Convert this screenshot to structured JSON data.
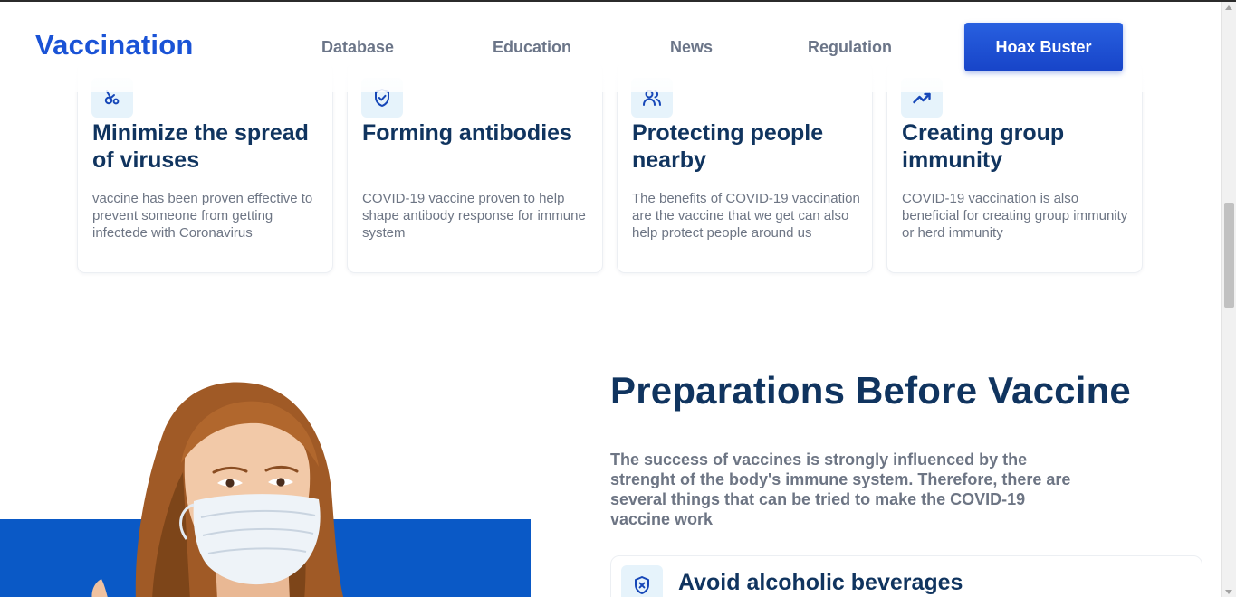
{
  "nav": {
    "brand": "Vaccination",
    "links": [
      {
        "label": "Database"
      },
      {
        "label": "Education"
      },
      {
        "label": "News"
      },
      {
        "label": "Regulation"
      }
    ],
    "cta": "Hoax Buster"
  },
  "benefits": [
    {
      "icon": "virus-icon",
      "title": "Minimize the spread of viruses",
      "text": "vaccine has been proven effective to prevent someone from getting infectede with Coronavirus"
    },
    {
      "icon": "shield-check-icon",
      "title": "Forming antibodies",
      "text": "COVID-19 vaccine proven to help shape antibody response for immune system"
    },
    {
      "icon": "people-icon",
      "title": "Protecting people nearby",
      "text": "The benefits of COVID-19 vaccination are the vaccine that we get can also help protect people around us"
    },
    {
      "icon": "trending-up-icon",
      "title": "Creating group immunity",
      "text": "COVID-19 vaccination is also beneficial for creating group immunity or herd immunity"
    }
  ],
  "preparation": {
    "title": "Preparations Before Vaccine",
    "text": "The success of vaccines is strongly influenced by the strenght of the body's immune system. Therefore, there are several things that can be tried to make the COVID-19 vaccine work",
    "tips": [
      {
        "icon": "shield-x-icon",
        "title": "Avoid alcoholic beverages"
      }
    ]
  },
  "colors": {
    "brand": "#1a53d6",
    "heading": "#10345f",
    "body_text": "#6d7584",
    "icon_bg": "#e6f3fb",
    "section_blue": "#0a59c6"
  }
}
